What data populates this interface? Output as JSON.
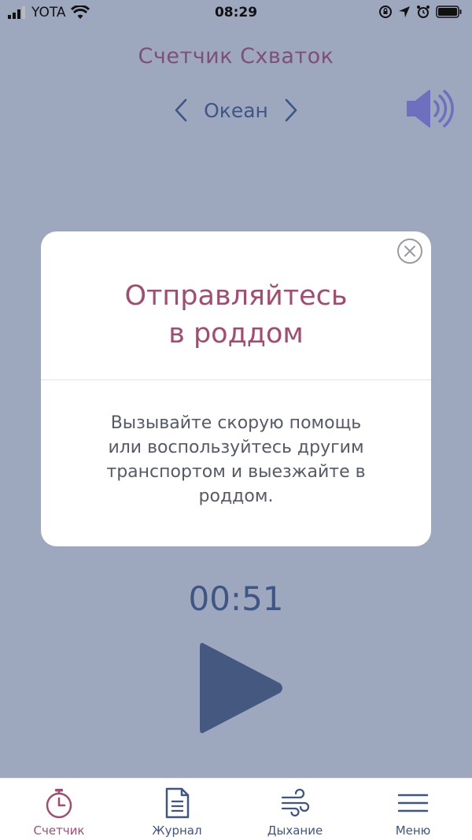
{
  "status_bar": {
    "carrier": "YOTA",
    "time": "08:29"
  },
  "header": {
    "title": "Счетчик Схваток",
    "sound_name": "Океан"
  },
  "modal": {
    "title_lines": [
      "Отправляйтесь",
      "в роддом"
    ],
    "body_lines": [
      "Вызывайте скорую помощь",
      "или воспользуйтесь другим",
      "транспортом и выезжайте в",
      "роддом."
    ]
  },
  "timer": {
    "value": "00:51"
  },
  "tabs": [
    {
      "label": "Счетчик",
      "icon": "stopwatch-icon",
      "active": true
    },
    {
      "label": "Журнал",
      "icon": "document-icon",
      "active": false
    },
    {
      "label": "Дыхание",
      "icon": "wind-icon",
      "active": false
    },
    {
      "label": "Меню",
      "icon": "menu-icon",
      "active": false
    }
  ],
  "colors": {
    "background": "#9da8bf",
    "accent_rose": "#a24d6f",
    "title_purple": "#7d4f7a",
    "navy": "#3f5583",
    "speaker": "#6f6fc0"
  }
}
